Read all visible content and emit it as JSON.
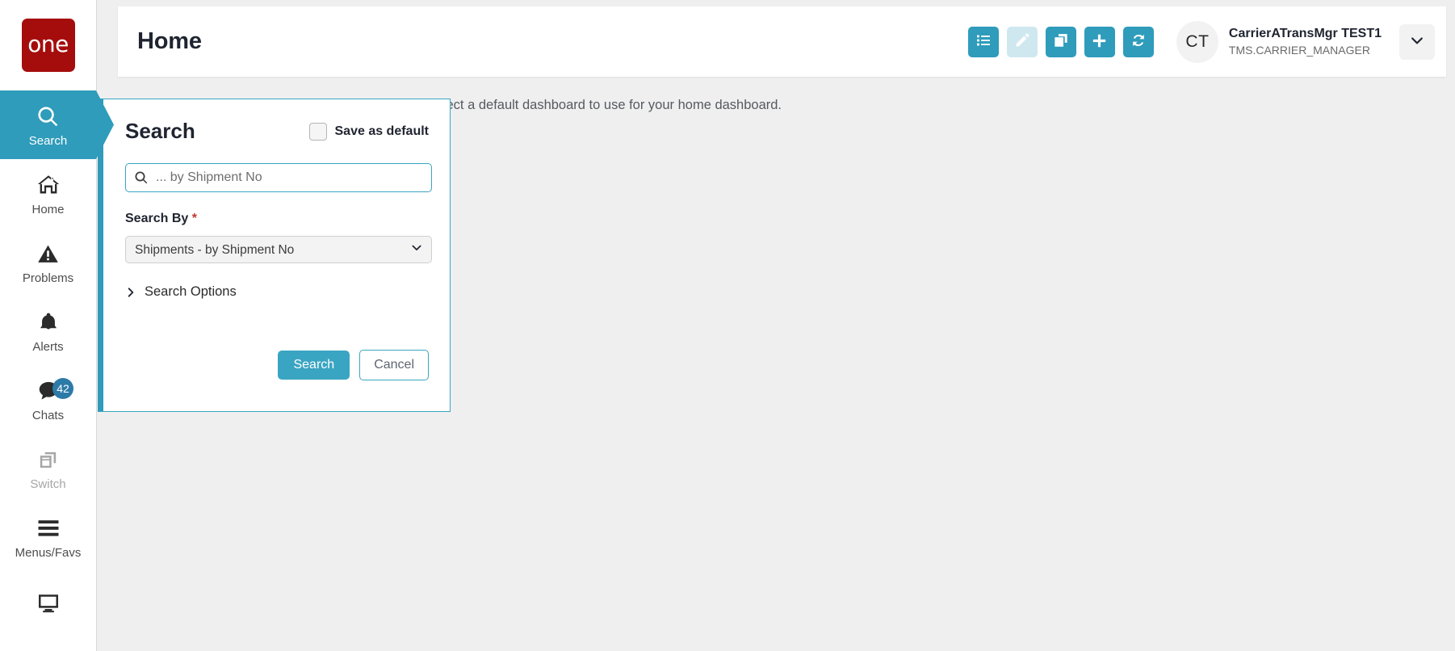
{
  "brand": {
    "logo_text": "one",
    "logo_color": "#a50d0d"
  },
  "theme": {
    "accent": "#2f9cbb",
    "accent_light": "#cfe8f0",
    "badge": "#2c7aa8",
    "required": "#c0392b"
  },
  "sidebar": {
    "items": [
      {
        "label": "Search",
        "icon": "search-icon",
        "active": true,
        "dim": false,
        "badge": null
      },
      {
        "label": "Home",
        "icon": "home-icon",
        "active": false,
        "dim": false,
        "badge": null
      },
      {
        "label": "Problems",
        "icon": "warning-triangle-icon",
        "active": false,
        "dim": false,
        "badge": null
      },
      {
        "label": "Alerts",
        "icon": "bell-icon",
        "active": false,
        "dim": false,
        "badge": null
      },
      {
        "label": "Chats",
        "icon": "chat-bubble-icon",
        "active": false,
        "dim": false,
        "badge": "42"
      },
      {
        "label": "Switch",
        "icon": "switch-windows-icon",
        "active": false,
        "dim": true,
        "badge": null
      },
      {
        "label": "Menus/Favs",
        "icon": "hamburger-menu-icon",
        "active": false,
        "dim": false,
        "badge": null
      },
      {
        "label": "",
        "icon": "monitor-icon",
        "active": false,
        "dim": false,
        "badge": null
      }
    ]
  },
  "header": {
    "title": "Home",
    "tools": [
      {
        "name": "list-view-button",
        "icon": "list-icon",
        "disabled": false
      },
      {
        "name": "edit-button",
        "icon": "pencil-icon",
        "disabled": true
      },
      {
        "name": "copy-button",
        "icon": "copy-icon",
        "disabled": false
      },
      {
        "name": "add-button",
        "icon": "plus-icon",
        "disabled": false
      },
      {
        "name": "refresh-button",
        "icon": "refresh-icon",
        "disabled": false
      }
    ],
    "user": {
      "initials": "CT",
      "name": "CarrierATransMgr TEST1",
      "role": "TMS.CARRIER_MANAGER"
    },
    "caret_icon": "chevron-down-icon"
  },
  "main": {
    "dashboard_message": "tem does not have one defined for your role. Please select a default dashboard to use for your home dashboard."
  },
  "search_panel": {
    "title": "Search",
    "save_as_default_label": "Save as default",
    "save_as_default_checked": false,
    "query_value": "",
    "query_placeholder": "... by Shipment No",
    "search_by_label": "Search By",
    "required_marker": "*",
    "search_by_value": "Shipments - by Shipment No",
    "search_by_options": [
      "Shipments - by Shipment No"
    ],
    "search_options_label": "Search Options",
    "search_options_expanded": false,
    "search_button_label": "Search",
    "cancel_button_label": "Cancel"
  }
}
